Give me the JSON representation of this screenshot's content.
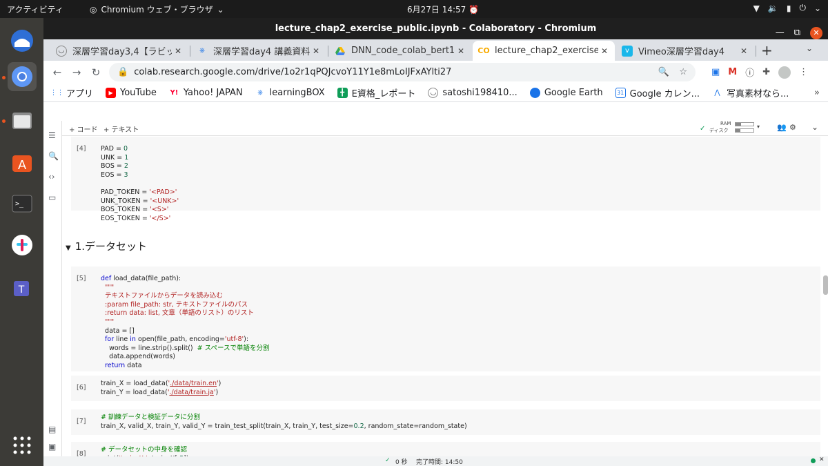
{
  "topbar": {
    "activities": "アクティビティ",
    "app_name": "Chromium ウェブ・ブラウザ",
    "datetime": "6月27日  14:57"
  },
  "window": {
    "title": "lecture_chap2_exercise_public.ipynb - Colaboratory - Chromium"
  },
  "tabs": [
    {
      "title": "深層学習day3,4【ラビッ",
      "icon": "ghost-icon"
    },
    {
      "title": "深層学習day4 講義資料",
      "icon": "learningbox-icon"
    },
    {
      "title": "DNN_code_colab_bert1b",
      "icon": "google-drive-icon"
    },
    {
      "title": "lecture_chap2_exercise_",
      "icon": "colab-icon",
      "active": true
    },
    {
      "title": "Vimeo深層学習day4",
      "icon": "vimeo-icon"
    }
  ],
  "address": {
    "url": "colab.research.google.com/drive/1o2r1qPQJcvoY11Y1e8mLoIJFxAYlti27"
  },
  "bookmarks": [
    {
      "label": "アプリ",
      "icon": "apps-icon"
    },
    {
      "label": "YouTube",
      "icon": "youtube-icon"
    },
    {
      "label": "Yahoo! JAPAN",
      "icon": "yahoo-icon"
    },
    {
      "label": "learningBOX",
      "icon": "learningbox-icon"
    },
    {
      "label": "E資格_レポート",
      "icon": "sheets-icon"
    },
    {
      "label": "satoshi198410...",
      "icon": "ghost-icon"
    },
    {
      "label": "Google Earth",
      "icon": "earth-icon"
    },
    {
      "label": "Google カレン...",
      "icon": "calendar-icon"
    },
    {
      "label": "写真素材なら...",
      "icon": "photo-icon"
    }
  ],
  "colab": {
    "add_code": "+ コード",
    "add_text": "+ テキスト",
    "ram_label": "RAM",
    "disk_label": "ディスク",
    "section_title": "1.データセット"
  },
  "cells": [
    {
      "num": "[4]"
    },
    {
      "num": "[5]"
    },
    {
      "num": "[6]"
    },
    {
      "num": "[7]"
    },
    {
      "num": "[8]"
    }
  ],
  "status": {
    "elapsed": "0 秒",
    "done_label": "完了時間: 14:50"
  },
  "colors": {
    "accent": "#e95420",
    "keyword": "#0000cc",
    "string": "#b22222",
    "comment": "#008000",
    "number": "#116644"
  }
}
